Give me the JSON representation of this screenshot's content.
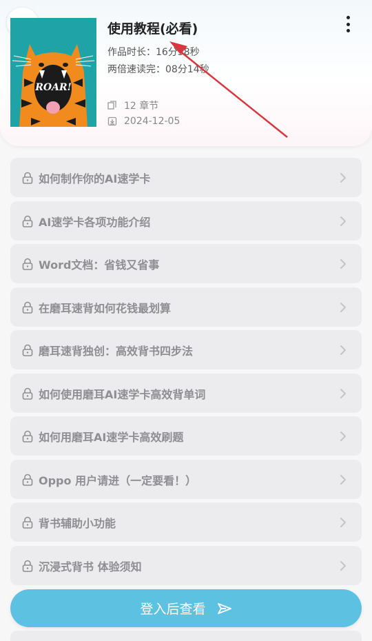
{
  "header": {
    "title": "使用教程(必看)",
    "duration": "作品时长：16分58秒",
    "double_speed": "两倍速读完：08分14秒",
    "chapter_count": "12 章节",
    "date": "2024-12-05",
    "cover_text": "ROAR!"
  },
  "chapters": [
    "如何制作你的AI速学卡",
    "AI速学卡各项功能介绍",
    "Word文档：省钱又省事",
    "在磨耳速背如何花钱最划算",
    "磨耳速背独创：高效背书四步法",
    "如何使用磨耳AI速学卡高效背单词",
    "如何用磨耳AI速学卡高效刷题",
    "Oppo 用户请进（一定要看！）",
    "背书辅助小功能",
    "沉浸式背书 体验须知"
  ],
  "login_button": "登入后查看",
  "colors": {
    "accent": "#5dc1e2",
    "cover_bg": "#1fa3a6",
    "arrow": "#d9373f",
    "chapter_bg": "#ececee",
    "chapter_text": "#8e8e93"
  },
  "icons": {
    "back": "chevron-left-icon",
    "more": "more-vertical-icon",
    "copy": "copy-icon",
    "download": "download-icon",
    "lock": "lock-icon",
    "chevron": "chevron-right-icon",
    "send": "send-icon"
  }
}
